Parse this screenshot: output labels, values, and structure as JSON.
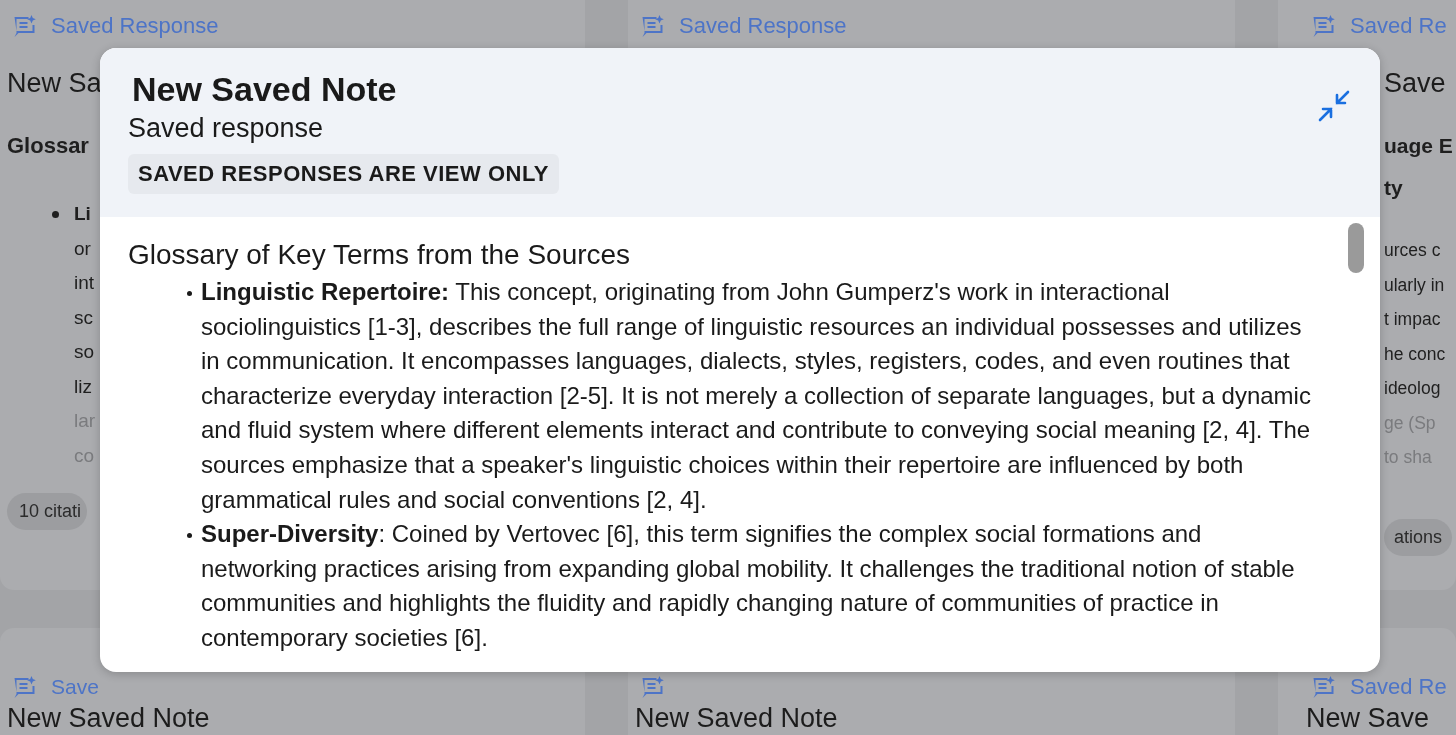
{
  "background_cards": [
    {
      "label": "Saved Response",
      "title": "New Sa",
      "heading": [
        "Glossar"
      ],
      "bullet": true,
      "lines": [
        {
          "text": "Li",
          "bold": true,
          "faded": false
        },
        {
          "text": "or",
          "bold": false,
          "faded": false
        },
        {
          "text": "int",
          "bold": false,
          "faded": false
        },
        {
          "text": "sc",
          "bold": false,
          "faded": false
        },
        {
          "text": "so",
          "bold": false,
          "faded": false
        },
        {
          "text": "liz",
          "bold": false,
          "faded": false
        },
        {
          "text": "lar",
          "bold": false,
          "faded": true
        },
        {
          "text": "co",
          "bold": false,
          "faded": true
        }
      ],
      "chip": "10 citati"
    },
    {
      "label": "Saved Response"
    },
    {
      "label": "Saved Re",
      "title": "Save",
      "heading": [
        "uage E",
        "ty"
      ],
      "bullet": false,
      "lines": [
        {
          "text": "urces c",
          "bold": false,
          "faded": false
        },
        {
          "text": "ularly in",
          "bold": false,
          "faded": false
        },
        {
          "text": "t impac",
          "bold": false,
          "faded": false
        },
        {
          "text": "he conc",
          "bold": false,
          "faded": false
        },
        {
          "text": "ideolog",
          "bold": false,
          "faded": false
        },
        {
          "text": "ge (Sp",
          "bold": false,
          "faded": true
        },
        {
          "text": "to sha",
          "bold": false,
          "faded": true
        }
      ],
      "chip": "ations"
    },
    {
      "label": "Save",
      "title": "New Saved Note"
    },
    {
      "title": "New Saved Note"
    },
    {
      "label": "Saved Re",
      "title": "New Save"
    }
  ],
  "dialog": {
    "title": "New Saved Note",
    "subtitle": "Saved response",
    "notice": "SAVED RESPONSES ARE VIEW ONLY",
    "heading": "Glossary of Key Terms from the Sources",
    "items": [
      "**Linguistic Repertoire:** This concept, originating from John Gumperz's work in interactional sociolinguistics [1-3], describes the full range of linguistic resources an individual possesses and utilizes in communication. It encompasses languages, dialects, styles, registers, codes, and even routines that characterize everyday interaction [2-5]. It is not merely a collection of separate languages, but a dynamic and fluid system where different elements interact and contribute to conveying social meaning [2, 4]. The sources emphasize that a speaker's linguistic choices within their repertoire are influenced by both grammatical rules and social conventions [2, 4].",
      "**Super-Diversity**: Coined by Vertovec [6], this term signifies the complex social formations and networking practices arising from expanding global mobility. It challenges the traditional notion of stable communities and highlights the fluidity and rapidly changing nature of communities of practice in contemporary societies [6]."
    ]
  }
}
